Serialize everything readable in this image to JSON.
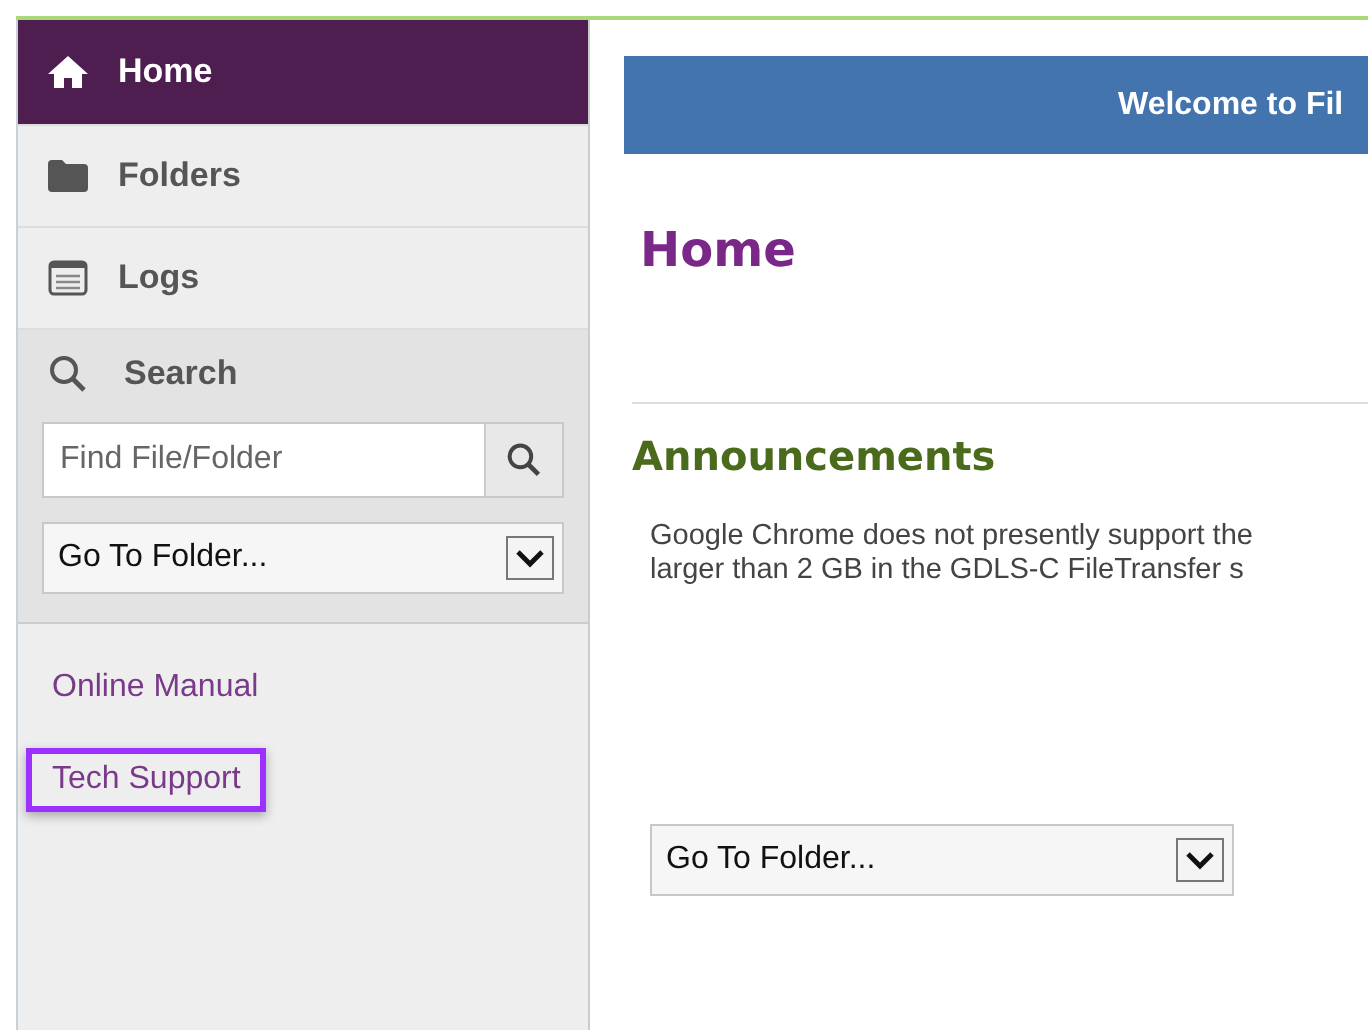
{
  "nav": [
    {
      "label": "Home",
      "kind": "home",
      "selected": true
    },
    {
      "label": "Folders",
      "kind": "folder",
      "selected": false
    },
    {
      "label": "Logs",
      "kind": "logs",
      "selected": false
    }
  ],
  "search": {
    "title": "Search",
    "placeholder": "Find File/Folder",
    "folder_select": "Go To Folder..."
  },
  "links": [
    {
      "label": "Online Manual",
      "highlighted": false
    },
    {
      "label": "Tech Support",
      "highlighted": true
    }
  ],
  "banner": {
    "title": "Welcome to Fil"
  },
  "page_title": "Home",
  "announcements": {
    "title": "Announcements",
    "lines": [
      "Google Chrome does not presently support the",
      "larger than 2 GB in the GDLS-C FileTransfer s"
    ]
  },
  "folder_select": "Go To Folder..."
}
